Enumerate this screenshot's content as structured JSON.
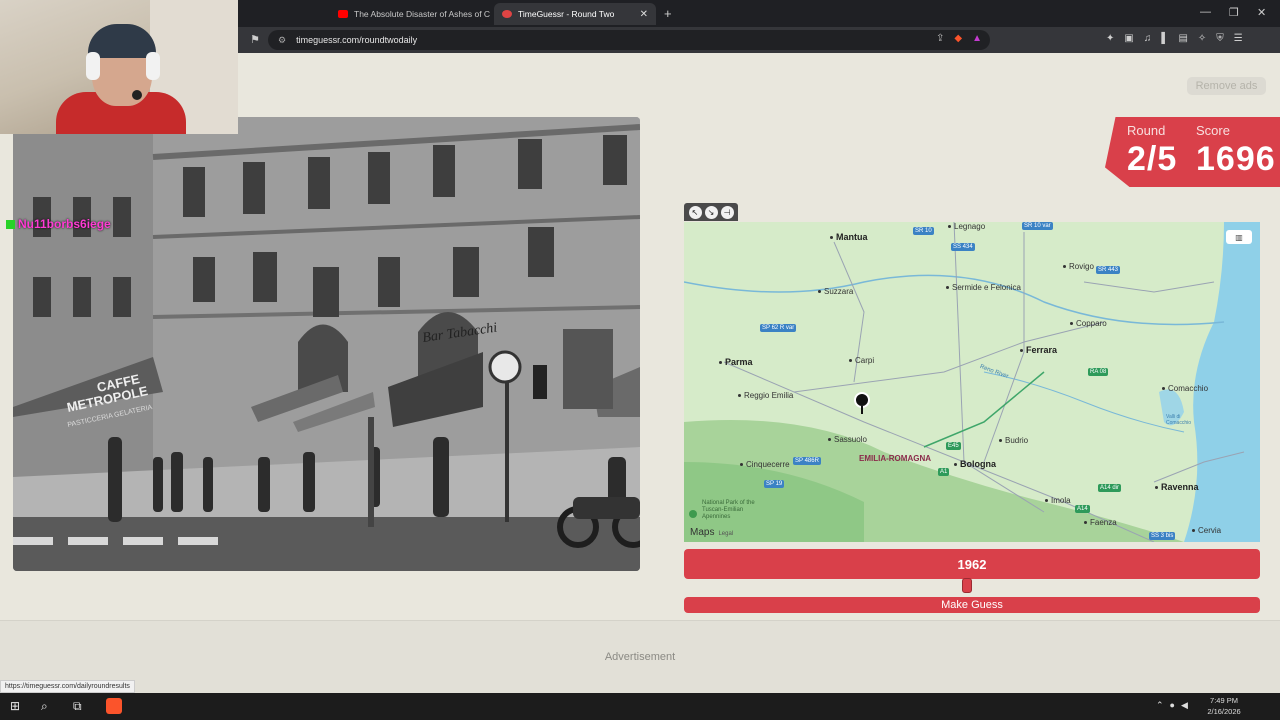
{
  "browser": {
    "tabs": [
      {
        "title": "The Absolute Disaster of Ashes of Cr",
        "favicon_color": "#ff0000"
      },
      {
        "title": "TimeGuessr - Round Two",
        "favicon_color": "#e04444"
      }
    ],
    "url": "timeguessr.com/roundtwodaily"
  },
  "stream_overlay": {
    "tag": "Nu11borbs6iege"
  },
  "header": {
    "remove_ads_label": "Remove ads"
  },
  "score_panel": {
    "round_label": "Round",
    "round_value": "2/5",
    "score_label": "Score",
    "score_value": "1696"
  },
  "photo": {
    "signs": {
      "caffe": "CAFFE",
      "metropole": "METROPOLE",
      "pasticceria": "PASTICCERIA GELATERIA",
      "bar": "Bar Tabacchi"
    }
  },
  "map": {
    "cities": [
      "Mantua",
      "Legnago",
      "Suzzara",
      "Sermide e Felonica",
      "Rovigo",
      "Copparo",
      "Parma",
      "Carpi",
      "Ferrara",
      "Reggio Emilia",
      "Sassuolo",
      "Budrio",
      "Comacchio",
      "Bologna",
      "Cinquecerre",
      "Imola",
      "Ravenna",
      "Faenza",
      "Cervia"
    ],
    "region": "EMILIA-ROMAGNA",
    "river": "Reno River",
    "lagoon": "Valli di Comacchio",
    "park": "National Park of the Tuscan-Emilian Apennines",
    "attribution": "Maps",
    "legal": "Legal",
    "shields": [
      "SR 10",
      "SS 434",
      "SR 10 var",
      "SR 443",
      "SP 62 R var",
      "RA 08",
      "E45",
      "SP 486R",
      "SP 19",
      "A1",
      "A14 dir",
      "A14",
      "SS 3 bis",
      "SS 16"
    ]
  },
  "guess": {
    "year": "1962",
    "button_label": "Make Guess"
  },
  "ad": {
    "label": "Advertisement"
  },
  "status_url": "https://timeguessr.com/dailyroundresults",
  "taskbar": {
    "time": "7:49 PM",
    "date": "2/16/2026"
  }
}
